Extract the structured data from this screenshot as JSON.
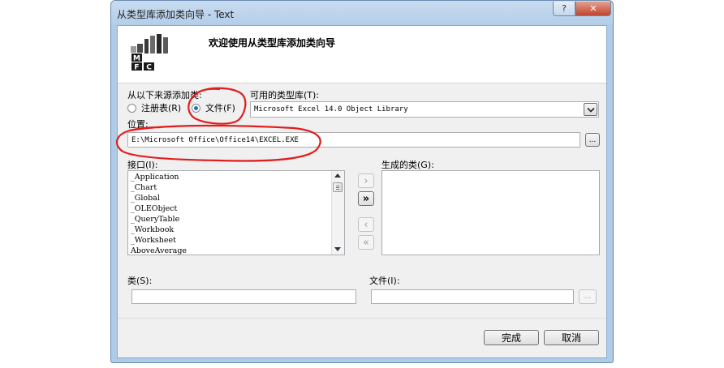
{
  "window": {
    "title": "从类型库添加类向导 - Text",
    "help_label": "?",
    "close_label": "✕"
  },
  "header": {
    "welcome": "欢迎使用从类型库添加类向导",
    "logo_letters": [
      "M",
      "F",
      "C"
    ]
  },
  "source": {
    "label": "从以下来源添加类:",
    "option_registry": "注册表(R)",
    "option_file": "文件(F)",
    "selected": "file"
  },
  "typelib": {
    "label": "可用的类型库(T):",
    "value": "Microsoft Excel 14.0 Object Library"
  },
  "location": {
    "label": "位置:",
    "value": "E:\\Microsoft Office\\Office14\\EXCEL.EXE",
    "browse_label": "..."
  },
  "interfaces": {
    "label": "接口(I):",
    "items": [
      "_Application",
      "_Chart",
      "_Global",
      "_OLEObject",
      "_QueryTable",
      "_Workbook",
      "_Worksheet",
      "AboveAverage"
    ]
  },
  "generated": {
    "label": "生成的类(G):",
    "items": []
  },
  "move_buttons": {
    "add_one": "›",
    "add_all": "»",
    "remove_one": "‹",
    "remove_all": "«"
  },
  "class_field": {
    "label": "类(S):",
    "value": ""
  },
  "file_field": {
    "label": "文件(I):",
    "value": "",
    "browse_label": "..."
  },
  "footer": {
    "finish_label": "完成",
    "cancel_label": "取消"
  },
  "colors": {
    "annotation": "#e21b1b",
    "window_frame": "#aecbe8",
    "dialog_bg": "#f0f0f0"
  }
}
